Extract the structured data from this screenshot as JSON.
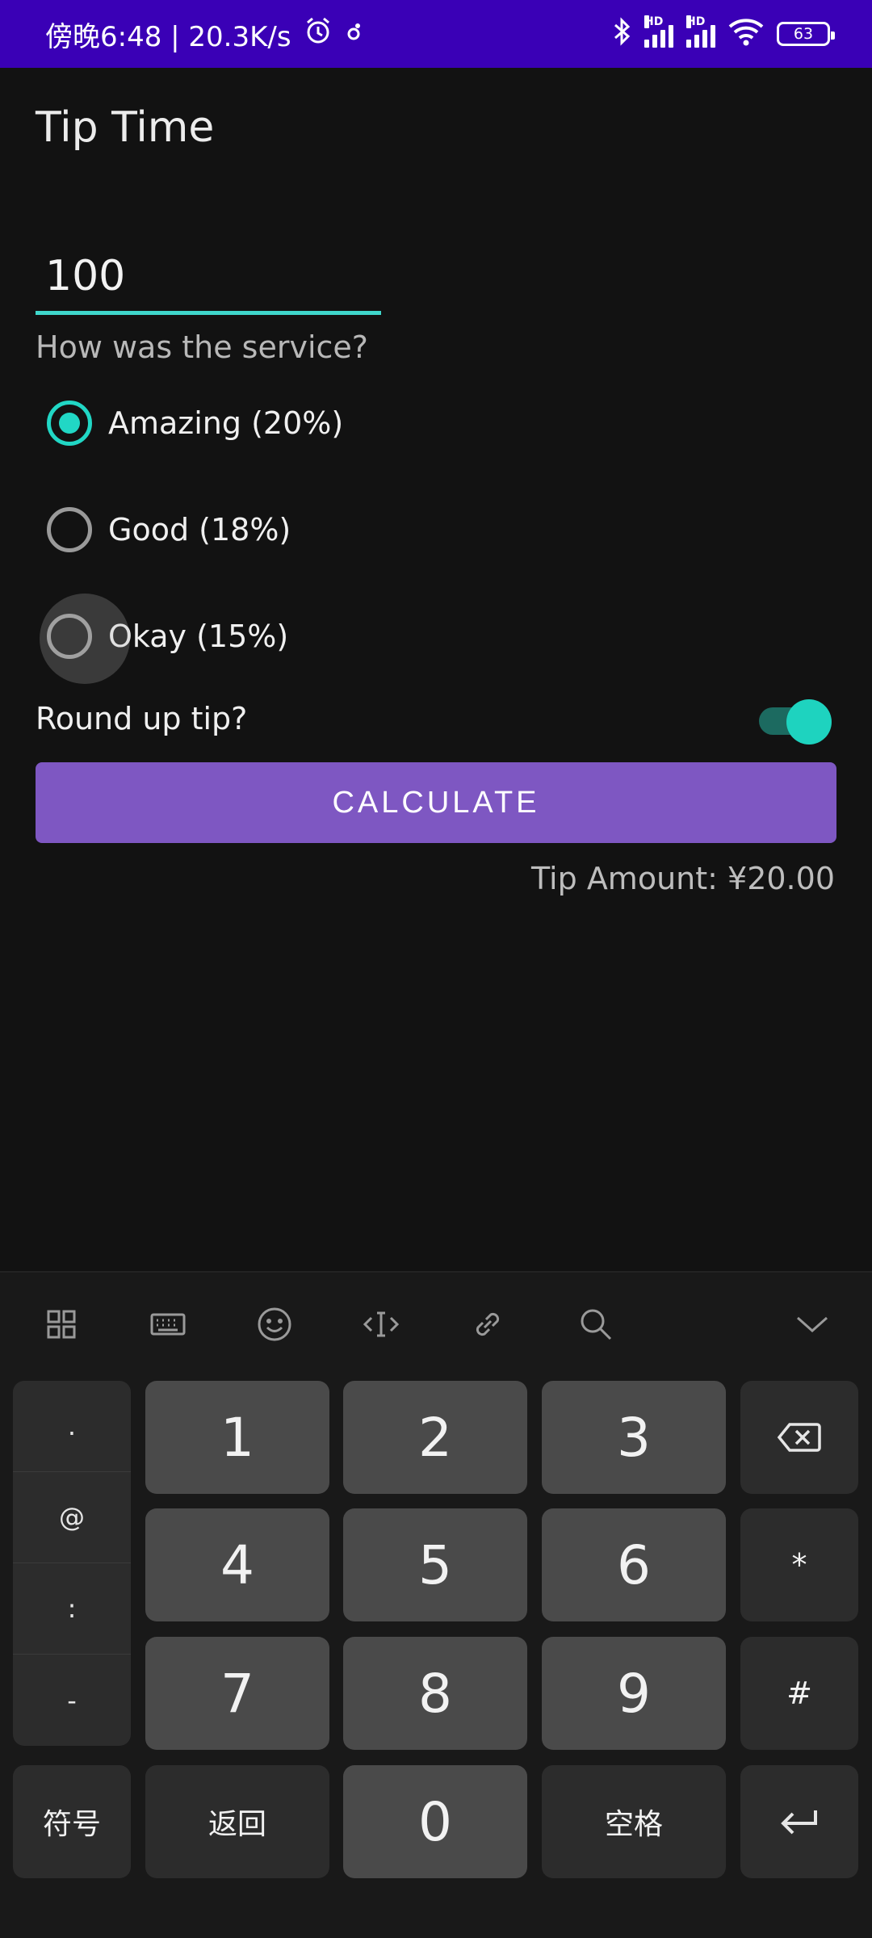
{
  "status_bar": {
    "time": "傍晚6:48 | 20.3K/s",
    "battery": "63",
    "signal_label": "HD"
  },
  "app": {
    "title": "Tip Time",
    "amount_value": "100",
    "question": "How was the service?",
    "options": [
      {
        "label": "Amazing (20%)",
        "checked": true
      },
      {
        "label": "Good (18%)",
        "checked": false
      },
      {
        "label": "Okay (15%)",
        "checked": false
      }
    ],
    "round_up_label": "Round up tip?",
    "round_up_on": true,
    "calculate_label": "CALCULATE",
    "tip_amount": "Tip Amount: ¥20.00"
  },
  "keyboard": {
    "toolbar_icons": [
      "grid-icon",
      "keyboard-icon",
      "emoji-icon",
      "cursor-icon",
      "link-icon",
      "search-icon",
      "collapse-icon"
    ],
    "symbols": [
      ".",
      "@",
      ":",
      "-"
    ],
    "digits": [
      "1",
      "2",
      "3",
      "4",
      "5",
      "6",
      "7",
      "8",
      "9",
      "0"
    ],
    "right_keys": [
      "⌫",
      "*",
      "#",
      "↵"
    ],
    "symbols_key": "符号",
    "back_key": "返回",
    "space_key": "空格"
  },
  "colors": {
    "status_bar": "#3a00b6",
    "accent": "#21d7c5",
    "button": "#7e57c2",
    "background": "#121212"
  }
}
